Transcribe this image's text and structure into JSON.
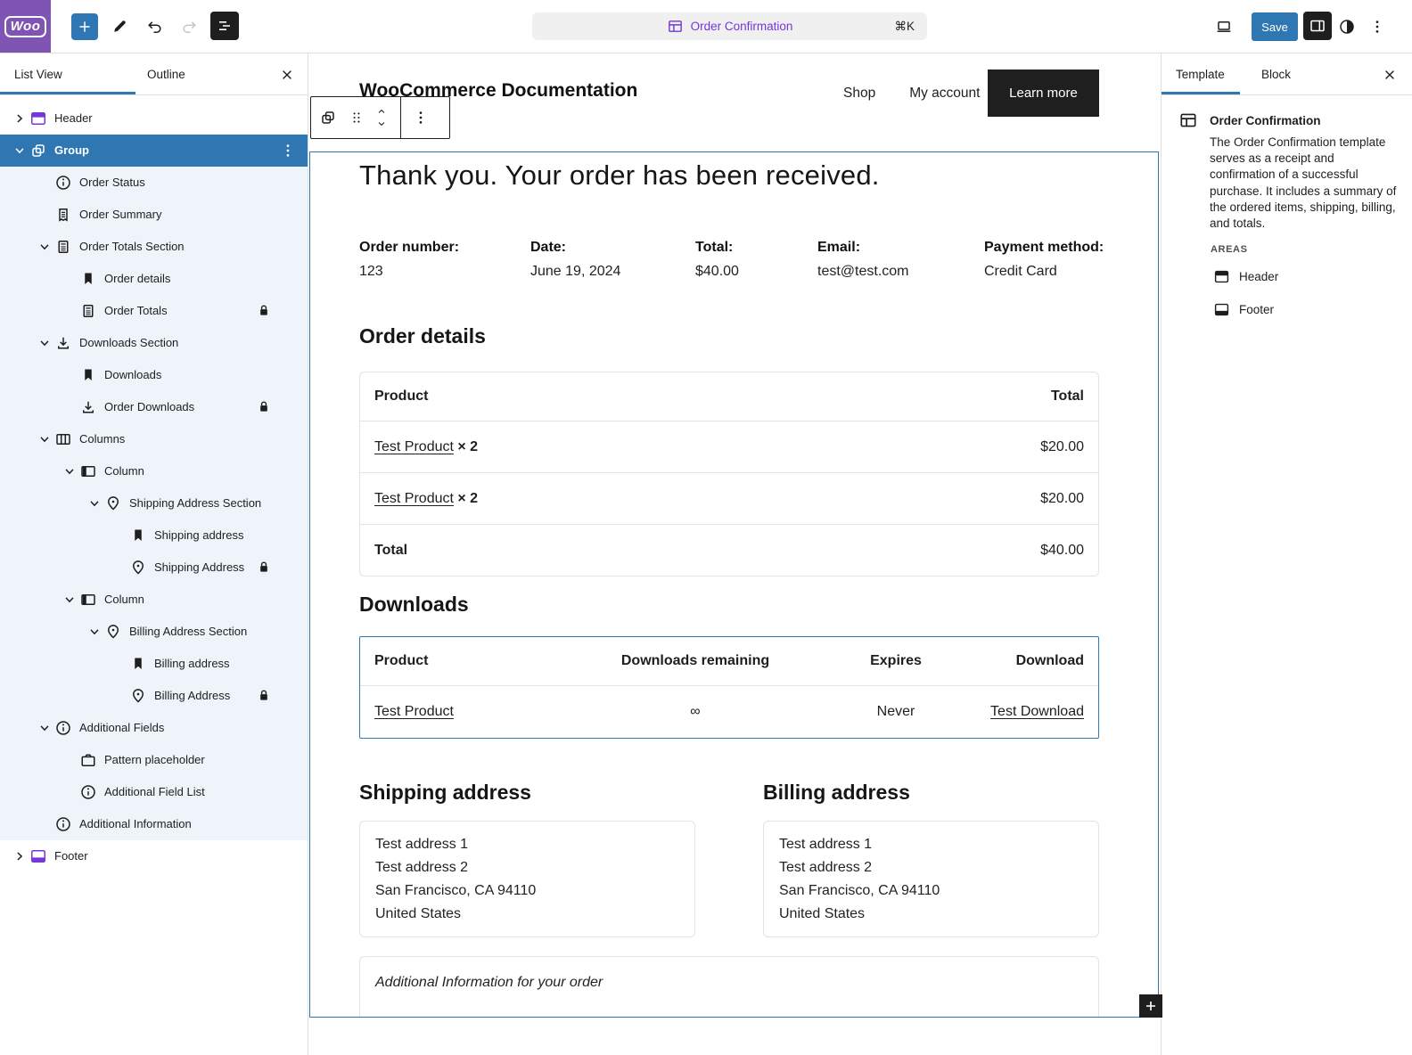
{
  "colors": {
    "accent": "#2e77b2",
    "woo_purple": "#7f54b3",
    "template_purple": "#7537d8",
    "dark": "#1e1e1e",
    "child_bg": "#eef4fa"
  },
  "topbar": {
    "logo_text": "Woo",
    "command": {
      "label": "Order Confirmation",
      "shortcut": "⌘K",
      "icon": "template-icon"
    },
    "save_label": "Save"
  },
  "left_panel": {
    "tabs": [
      {
        "label": "List View"
      },
      {
        "label": "Outline"
      }
    ],
    "items": [
      {
        "label": "Header",
        "level": 0,
        "icon": "header-icon",
        "chevron": "right",
        "purple": true
      },
      {
        "label": "Group",
        "level": 0,
        "icon": "group-icon",
        "chevron": "down",
        "selected": true,
        "menu": true
      },
      {
        "label": "Order Status",
        "level": 1,
        "icon": "info-icon"
      },
      {
        "label": "Order Summary",
        "level": 1,
        "icon": "receipt-icon"
      },
      {
        "label": "Order Totals Section",
        "level": 1,
        "icon": "calculator-icon",
        "chevron": "down"
      },
      {
        "label": "Order details",
        "level": 2,
        "icon": "bookmark-icon"
      },
      {
        "label": "Order Totals",
        "level": 2,
        "icon": "calculator-icon",
        "locked": true
      },
      {
        "label": "Downloads Section",
        "level": 1,
        "icon": "download-icon",
        "chevron": "down"
      },
      {
        "label": "Downloads",
        "level": 2,
        "icon": "bookmark-icon"
      },
      {
        "label": "Order Downloads",
        "level": 2,
        "icon": "download-icon",
        "locked": true
      },
      {
        "label": "Columns",
        "level": 1,
        "icon": "columns-icon",
        "chevron": "down"
      },
      {
        "label": "Column",
        "level": 2,
        "icon": "column-icon",
        "chevron": "down"
      },
      {
        "label": "Shipping Address Section",
        "level": 3,
        "icon": "pin-icon",
        "chevron": "down"
      },
      {
        "label": "Shipping address",
        "level": 4,
        "icon": "bookmark-icon"
      },
      {
        "label": "Shipping Address",
        "level": 4,
        "icon": "pin-icon",
        "locked": true
      },
      {
        "label": "Column",
        "level": 2,
        "icon": "column-icon",
        "chevron": "down"
      },
      {
        "label": "Billing Address Section",
        "level": 3,
        "icon": "pin-icon",
        "chevron": "down"
      },
      {
        "label": "Billing address",
        "level": 4,
        "icon": "bookmark-icon"
      },
      {
        "label": "Billing Address",
        "level": 4,
        "icon": "pin-icon",
        "locked": true
      },
      {
        "label": "Additional Fields",
        "level": 1,
        "icon": "info-icon",
        "chevron": "down"
      },
      {
        "label": "Pattern placeholder",
        "level": 2,
        "icon": "pattern-icon"
      },
      {
        "label": "Additional Field List",
        "level": 2,
        "icon": "info-icon"
      },
      {
        "label": "Additional Information",
        "level": 1,
        "icon": "info-icon"
      },
      {
        "label": "Footer",
        "level": 0,
        "icon": "footer-icon",
        "chevron": "right",
        "purple": true
      }
    ]
  },
  "canvas": {
    "site_title": "WooCommerce Documentation",
    "nav": [
      "Shop",
      "My account"
    ],
    "cta_label": "Learn more",
    "heading": "Thank you. Your order has been received.",
    "order_info": [
      {
        "label": "Order number:",
        "value": "123"
      },
      {
        "label": "Date:",
        "value": "June 19, 2024"
      },
      {
        "label": "Total:",
        "value": "$40.00"
      },
      {
        "label": "Email:",
        "value": "test@test.com"
      },
      {
        "label": "Payment method:",
        "value": "Credit Card"
      }
    ],
    "order_details": {
      "title": "Order details",
      "headers": [
        "Product",
        "Total"
      ],
      "rows": [
        {
          "product": "Test Product",
          "qty": "× 2",
          "total": "$20.00"
        },
        {
          "product": "Test Product",
          "qty": "× 2",
          "total": "$20.00"
        }
      ],
      "total_label": "Total",
      "total_value": "$40.00"
    },
    "downloads": {
      "title": "Downloads",
      "headers": [
        "Product",
        "Downloads remaining",
        "Expires",
        "Download"
      ],
      "rows": [
        {
          "product": "Test Product",
          "remaining": "∞",
          "expires": "Never",
          "download": "Test Download"
        }
      ]
    },
    "shipping": {
      "title": "Shipping address",
      "lines": [
        "Test address 1",
        "Test address 2",
        "San Francisco, CA 94110",
        "United States"
      ]
    },
    "billing": {
      "title": "Billing address",
      "lines": [
        "Test address 1",
        "Test address 2",
        "San Francisco, CA 94110",
        "United States"
      ]
    },
    "additional_info": "Additional Information for your order"
  },
  "right_panel": {
    "tabs": [
      {
        "label": "Template"
      },
      {
        "label": "Block"
      }
    ],
    "template": {
      "title": "Order Confirmation",
      "description": "The Order Confirmation template serves as a receipt and confirmation of a successful purchase. It includes a summary of the ordered items, shipping, billing, and totals.",
      "areas_label": "AREAS",
      "areas": [
        {
          "label": "Header",
          "icon": "header-icon"
        },
        {
          "label": "Footer",
          "icon": "footer-icon"
        }
      ]
    }
  }
}
